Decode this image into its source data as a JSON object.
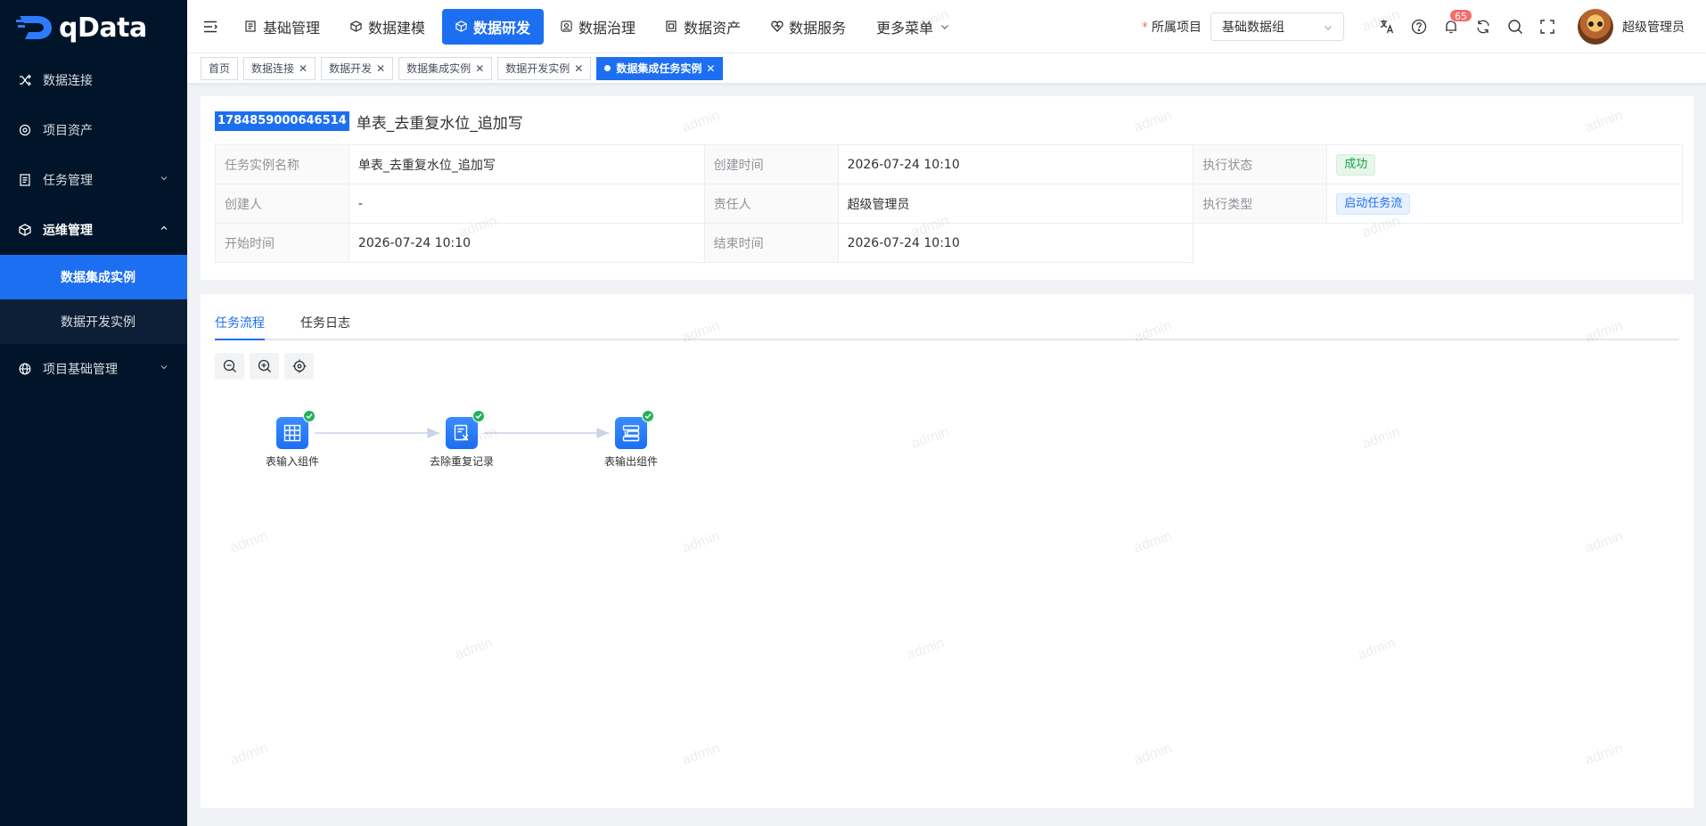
{
  "logo": {
    "text": "qData"
  },
  "sidebar": {
    "items": [
      {
        "label": "数据连接",
        "icon": "shuffle-icon"
      },
      {
        "label": "项目资产",
        "icon": "asset-icon"
      },
      {
        "label": "任务管理",
        "icon": "list-icon"
      },
      {
        "label": "运维管理",
        "icon": "cube-icon"
      },
      {
        "label": "项目基础管理",
        "icon": "globe-icon"
      }
    ],
    "ops_sub": [
      {
        "label": "数据集成实例"
      },
      {
        "label": "数据开发实例"
      }
    ]
  },
  "header": {
    "nav": [
      {
        "label": "基础管理"
      },
      {
        "label": "数据建模"
      },
      {
        "label": "数据研发"
      },
      {
        "label": "数据治理"
      },
      {
        "label": "数据资产"
      },
      {
        "label": "数据服务"
      },
      {
        "label": "更多菜单"
      }
    ],
    "project_label": "所属项目",
    "project_required_mark": "*",
    "project_value": "基础数据组",
    "notification_count": "65",
    "user_name": "超级管理员"
  },
  "tags": [
    {
      "label": "首页"
    },
    {
      "label": "数据连接"
    },
    {
      "label": "数据开发"
    },
    {
      "label": "数据集成实例"
    },
    {
      "label": "数据开发实例"
    },
    {
      "label": "数据集成任务实例"
    }
  ],
  "detail": {
    "id": "1784859000646514",
    "title": "单表_去重复水位_追加写",
    "rows": [
      [
        {
          "label": "任务实例名称",
          "value": "单表_去重复水位_追加写"
        },
        {
          "label": "创建时间",
          "value": "2026-07-24 10:10"
        },
        {
          "label": "执行状态",
          "value": "成功"
        }
      ],
      [
        {
          "label": "创建人",
          "value": "-"
        },
        {
          "label": "责任人",
          "value": "超级管理员"
        },
        {
          "label": "执行类型",
          "value": "启动任务流"
        }
      ],
      [
        {
          "label": "开始时间",
          "value": "2026-07-24 10:10"
        },
        {
          "label": "结束时间",
          "value": "2026-07-24 10:10"
        }
      ]
    ],
    "status_color": "#15a34a",
    "accent_color": "#1d6ff2"
  },
  "tabs": [
    {
      "label": "任务流程"
    },
    {
      "label": "任务日志"
    }
  ],
  "flow": {
    "nodes": [
      {
        "label": "表输入组件",
        "icon": "table-grid-icon"
      },
      {
        "label": "去除重复记录",
        "icon": "dedupe-icon"
      },
      {
        "label": "表输出组件",
        "icon": "table-output-icon"
      }
    ]
  },
  "watermark": "admin"
}
